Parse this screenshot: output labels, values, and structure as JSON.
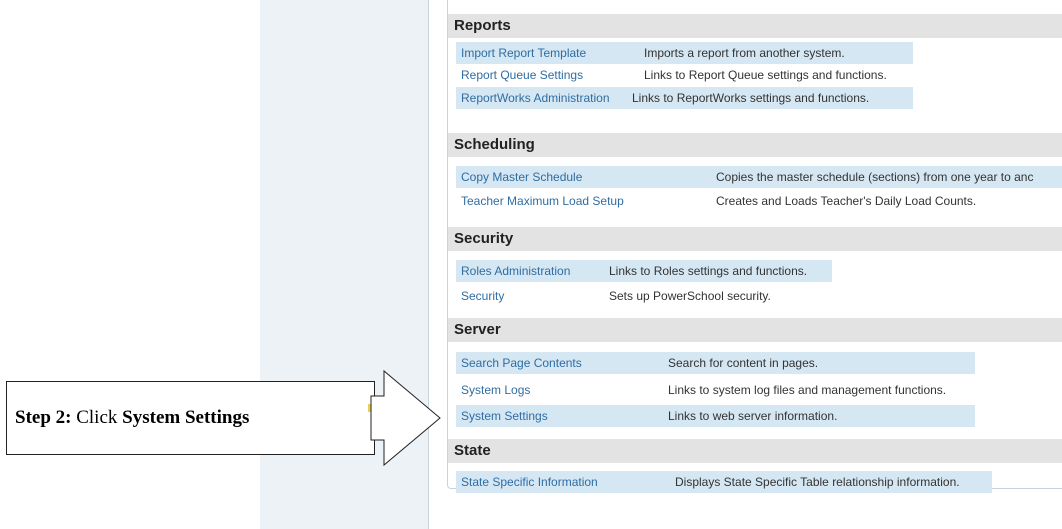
{
  "sections": {
    "reports": {
      "title": "Reports",
      "items": [
        {
          "link": "Import Report Template",
          "desc": "Imports a report from another system."
        },
        {
          "link": "Report Queue Settings",
          "desc": "Links to Report Queue settings and functions."
        },
        {
          "link": "ReportWorks Administration",
          "desc": "Links to ReportWorks settings and functions."
        }
      ]
    },
    "scheduling": {
      "title": "Scheduling",
      "items": [
        {
          "link": "Copy Master Schedule",
          "desc": "Copies the master schedule (sections) from one year to anc"
        },
        {
          "link": "Teacher Maximum Load Setup",
          "desc": "Creates and Loads Teacher's Daily Load Counts."
        }
      ]
    },
    "security": {
      "title": "Security",
      "items": [
        {
          "link": "Roles Administration",
          "desc": "Links to Roles settings and functions."
        },
        {
          "link": "Security",
          "desc": "Sets up PowerSchool security."
        }
      ]
    },
    "server": {
      "title": "Server",
      "items": [
        {
          "link": "Search Page Contents",
          "desc": "Search for content in pages."
        },
        {
          "link": "System Logs",
          "desc": "Links to system log files and management functions."
        },
        {
          "link": "System Settings",
          "desc": "Links to web server information."
        }
      ]
    },
    "state": {
      "title": "State",
      "items": [
        {
          "link": "State Specific Information",
          "desc": "Displays State Specific Table relationship information."
        }
      ]
    }
  },
  "callout": {
    "step": "Step 2:",
    "verb": " Click ",
    "target": "System Settings"
  }
}
